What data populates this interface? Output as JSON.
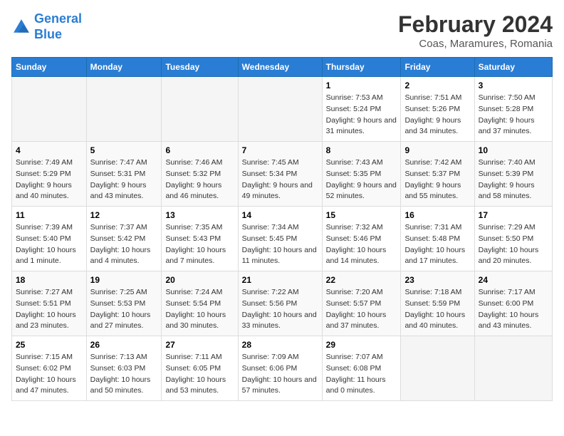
{
  "header": {
    "logo_general": "General",
    "logo_blue": "Blue",
    "title": "February 2024",
    "subtitle": "Coas, Maramures, Romania"
  },
  "weekdays": [
    "Sunday",
    "Monday",
    "Tuesday",
    "Wednesday",
    "Thursday",
    "Friday",
    "Saturday"
  ],
  "weeks": [
    [
      {
        "day": "",
        "sunrise": "",
        "sunset": "",
        "daylight": ""
      },
      {
        "day": "",
        "sunrise": "",
        "sunset": "",
        "daylight": ""
      },
      {
        "day": "",
        "sunrise": "",
        "sunset": "",
        "daylight": ""
      },
      {
        "day": "",
        "sunrise": "",
        "sunset": "",
        "daylight": ""
      },
      {
        "day": "1",
        "sunrise": "Sunrise: 7:53 AM",
        "sunset": "Sunset: 5:24 PM",
        "daylight": "Daylight: 9 hours and 31 minutes."
      },
      {
        "day": "2",
        "sunrise": "Sunrise: 7:51 AM",
        "sunset": "Sunset: 5:26 PM",
        "daylight": "Daylight: 9 hours and 34 minutes."
      },
      {
        "day": "3",
        "sunrise": "Sunrise: 7:50 AM",
        "sunset": "Sunset: 5:28 PM",
        "daylight": "Daylight: 9 hours and 37 minutes."
      }
    ],
    [
      {
        "day": "4",
        "sunrise": "Sunrise: 7:49 AM",
        "sunset": "Sunset: 5:29 PM",
        "daylight": "Daylight: 9 hours and 40 minutes."
      },
      {
        "day": "5",
        "sunrise": "Sunrise: 7:47 AM",
        "sunset": "Sunset: 5:31 PM",
        "daylight": "Daylight: 9 hours and 43 minutes."
      },
      {
        "day": "6",
        "sunrise": "Sunrise: 7:46 AM",
        "sunset": "Sunset: 5:32 PM",
        "daylight": "Daylight: 9 hours and 46 minutes."
      },
      {
        "day": "7",
        "sunrise": "Sunrise: 7:45 AM",
        "sunset": "Sunset: 5:34 PM",
        "daylight": "Daylight: 9 hours and 49 minutes."
      },
      {
        "day": "8",
        "sunrise": "Sunrise: 7:43 AM",
        "sunset": "Sunset: 5:35 PM",
        "daylight": "Daylight: 9 hours and 52 minutes."
      },
      {
        "day": "9",
        "sunrise": "Sunrise: 7:42 AM",
        "sunset": "Sunset: 5:37 PM",
        "daylight": "Daylight: 9 hours and 55 minutes."
      },
      {
        "day": "10",
        "sunrise": "Sunrise: 7:40 AM",
        "sunset": "Sunset: 5:39 PM",
        "daylight": "Daylight: 9 hours and 58 minutes."
      }
    ],
    [
      {
        "day": "11",
        "sunrise": "Sunrise: 7:39 AM",
        "sunset": "Sunset: 5:40 PM",
        "daylight": "Daylight: 10 hours and 1 minute."
      },
      {
        "day": "12",
        "sunrise": "Sunrise: 7:37 AM",
        "sunset": "Sunset: 5:42 PM",
        "daylight": "Daylight: 10 hours and 4 minutes."
      },
      {
        "day": "13",
        "sunrise": "Sunrise: 7:35 AM",
        "sunset": "Sunset: 5:43 PM",
        "daylight": "Daylight: 10 hours and 7 minutes."
      },
      {
        "day": "14",
        "sunrise": "Sunrise: 7:34 AM",
        "sunset": "Sunset: 5:45 PM",
        "daylight": "Daylight: 10 hours and 11 minutes."
      },
      {
        "day": "15",
        "sunrise": "Sunrise: 7:32 AM",
        "sunset": "Sunset: 5:46 PM",
        "daylight": "Daylight: 10 hours and 14 minutes."
      },
      {
        "day": "16",
        "sunrise": "Sunrise: 7:31 AM",
        "sunset": "Sunset: 5:48 PM",
        "daylight": "Daylight: 10 hours and 17 minutes."
      },
      {
        "day": "17",
        "sunrise": "Sunrise: 7:29 AM",
        "sunset": "Sunset: 5:50 PM",
        "daylight": "Daylight: 10 hours and 20 minutes."
      }
    ],
    [
      {
        "day": "18",
        "sunrise": "Sunrise: 7:27 AM",
        "sunset": "Sunset: 5:51 PM",
        "daylight": "Daylight: 10 hours and 23 minutes."
      },
      {
        "day": "19",
        "sunrise": "Sunrise: 7:25 AM",
        "sunset": "Sunset: 5:53 PM",
        "daylight": "Daylight: 10 hours and 27 minutes."
      },
      {
        "day": "20",
        "sunrise": "Sunrise: 7:24 AM",
        "sunset": "Sunset: 5:54 PM",
        "daylight": "Daylight: 10 hours and 30 minutes."
      },
      {
        "day": "21",
        "sunrise": "Sunrise: 7:22 AM",
        "sunset": "Sunset: 5:56 PM",
        "daylight": "Daylight: 10 hours and 33 minutes."
      },
      {
        "day": "22",
        "sunrise": "Sunrise: 7:20 AM",
        "sunset": "Sunset: 5:57 PM",
        "daylight": "Daylight: 10 hours and 37 minutes."
      },
      {
        "day": "23",
        "sunrise": "Sunrise: 7:18 AM",
        "sunset": "Sunset: 5:59 PM",
        "daylight": "Daylight: 10 hours and 40 minutes."
      },
      {
        "day": "24",
        "sunrise": "Sunrise: 7:17 AM",
        "sunset": "Sunset: 6:00 PM",
        "daylight": "Daylight: 10 hours and 43 minutes."
      }
    ],
    [
      {
        "day": "25",
        "sunrise": "Sunrise: 7:15 AM",
        "sunset": "Sunset: 6:02 PM",
        "daylight": "Daylight: 10 hours and 47 minutes."
      },
      {
        "day": "26",
        "sunrise": "Sunrise: 7:13 AM",
        "sunset": "Sunset: 6:03 PM",
        "daylight": "Daylight: 10 hours and 50 minutes."
      },
      {
        "day": "27",
        "sunrise": "Sunrise: 7:11 AM",
        "sunset": "Sunset: 6:05 PM",
        "daylight": "Daylight: 10 hours and 53 minutes."
      },
      {
        "day": "28",
        "sunrise": "Sunrise: 7:09 AM",
        "sunset": "Sunset: 6:06 PM",
        "daylight": "Daylight: 10 hours and 57 minutes."
      },
      {
        "day": "29",
        "sunrise": "Sunrise: 7:07 AM",
        "sunset": "Sunset: 6:08 PM",
        "daylight": "Daylight: 11 hours and 0 minutes."
      },
      {
        "day": "",
        "sunrise": "",
        "sunset": "",
        "daylight": ""
      },
      {
        "day": "",
        "sunrise": "",
        "sunset": "",
        "daylight": ""
      }
    ]
  ]
}
